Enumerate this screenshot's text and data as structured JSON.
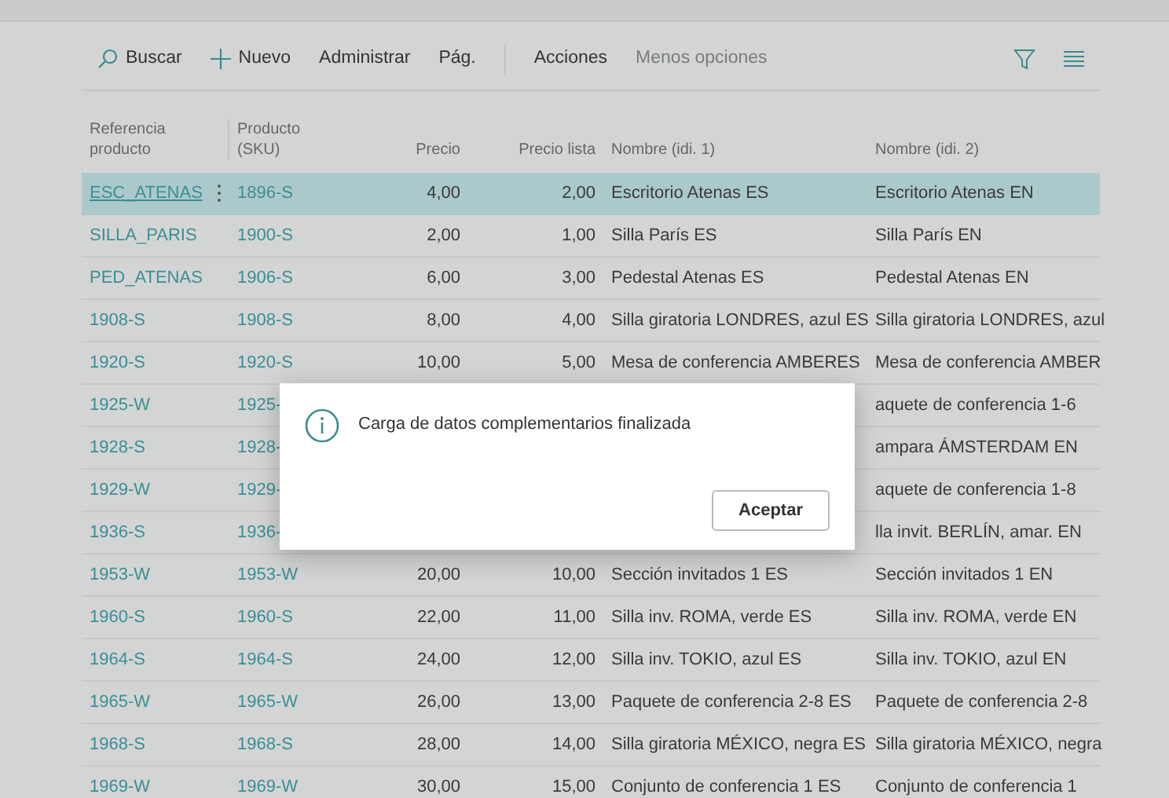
{
  "toolbar": {
    "items": [
      {
        "kind": "search",
        "label": "Buscar"
      },
      {
        "kind": "new",
        "label": "Nuevo"
      },
      {
        "kind": "plain",
        "label": "Administrar"
      },
      {
        "kind": "plain",
        "label": "Pág."
      },
      {
        "kind": "divider"
      },
      {
        "kind": "plain",
        "label": "Acciones"
      },
      {
        "kind": "muted",
        "label": "Menos opciones"
      }
    ]
  },
  "table": {
    "columns": [
      {
        "label": "Referencia producto"
      },
      {
        "label": "Producto (SKU)"
      },
      {
        "label": "Precio"
      },
      {
        "label": "Precio lista"
      },
      {
        "label": "Nombre (idi. 1)"
      },
      {
        "label": "Nombre (idi. 2)"
      }
    ],
    "rows": [
      {
        "selected": true,
        "cells": [
          "ESC_ATENAS",
          "1896-S",
          "4,00",
          "2,00",
          "Escritorio Atenas ES",
          "Escritorio Atenas EN"
        ]
      },
      {
        "selected": false,
        "cells": [
          "SILLA_PARIS",
          "1900-S",
          "2,00",
          "1,00",
          "Silla París ES",
          "Silla París EN"
        ]
      },
      {
        "selected": false,
        "cells": [
          "PED_ATENAS",
          "1906-S",
          "6,00",
          "3,00",
          "Pedestal Atenas ES",
          "Pedestal Atenas EN"
        ]
      },
      {
        "selected": false,
        "cells": [
          "1908-S",
          "1908-S",
          "8,00",
          "4,00",
          "Silla giratoria LONDRES, azul ES",
          "Silla giratoria LONDRES, azul"
        ]
      },
      {
        "selected": false,
        "cells": [
          "1920-S",
          "1920-S",
          "10,00",
          "5,00",
          "Mesa de conferencia AMBERES",
          "Mesa de conferencia AMBER"
        ]
      },
      {
        "selected": false,
        "cells": [
          "1925-W",
          "1925-",
          null,
          null,
          null,
          "aquete de conferencia 1-6"
        ]
      },
      {
        "selected": false,
        "cells": [
          "1928-S",
          "1928-",
          null,
          null,
          null,
          "ampara ÁMSTERDAM EN"
        ]
      },
      {
        "selected": false,
        "cells": [
          "1929-W",
          "1929-",
          null,
          null,
          null,
          "aquete de conferencia 1-8"
        ]
      },
      {
        "selected": false,
        "cells": [
          "1936-S",
          "1936-",
          null,
          null,
          null,
          "lla invit. BERLÍN, amar. EN"
        ]
      },
      {
        "selected": false,
        "cells": [
          "1953-W",
          "1953-W",
          "20,00",
          "10,00",
          "Sección invitados 1 ES",
          "Sección invitados 1 EN"
        ]
      },
      {
        "selected": false,
        "cells": [
          "1960-S",
          "1960-S",
          "22,00",
          "11,00",
          "Silla inv. ROMA, verde ES",
          "Silla inv. ROMA, verde EN"
        ]
      },
      {
        "selected": false,
        "cells": [
          "1964-S",
          "1964-S",
          "24,00",
          "12,00",
          "Silla inv. TOKIO, azul ES",
          "Silla inv. TOKIO, azul EN"
        ]
      },
      {
        "selected": false,
        "cells": [
          "1965-W",
          "1965-W",
          "26,00",
          "13,00",
          "Paquete de conferencia 2-8 ES",
          "Paquete de conferencia 2-8"
        ]
      },
      {
        "selected": false,
        "cells": [
          "1968-S",
          "1968-S",
          "28,00",
          "14,00",
          "Silla giratoria MÉXICO, negra ES",
          "Silla giratoria MÉXICO, negra"
        ]
      },
      {
        "selected": false,
        "cells": [
          "1969-W",
          "1969-W",
          "30,00",
          "15,00",
          "Conjunto de conferencia 1 ES",
          "Conjunto de conferencia 1"
        ]
      }
    ]
  },
  "dialog": {
    "message": "Carga de datos complementarios finalizada",
    "button": "Aceptar"
  }
}
